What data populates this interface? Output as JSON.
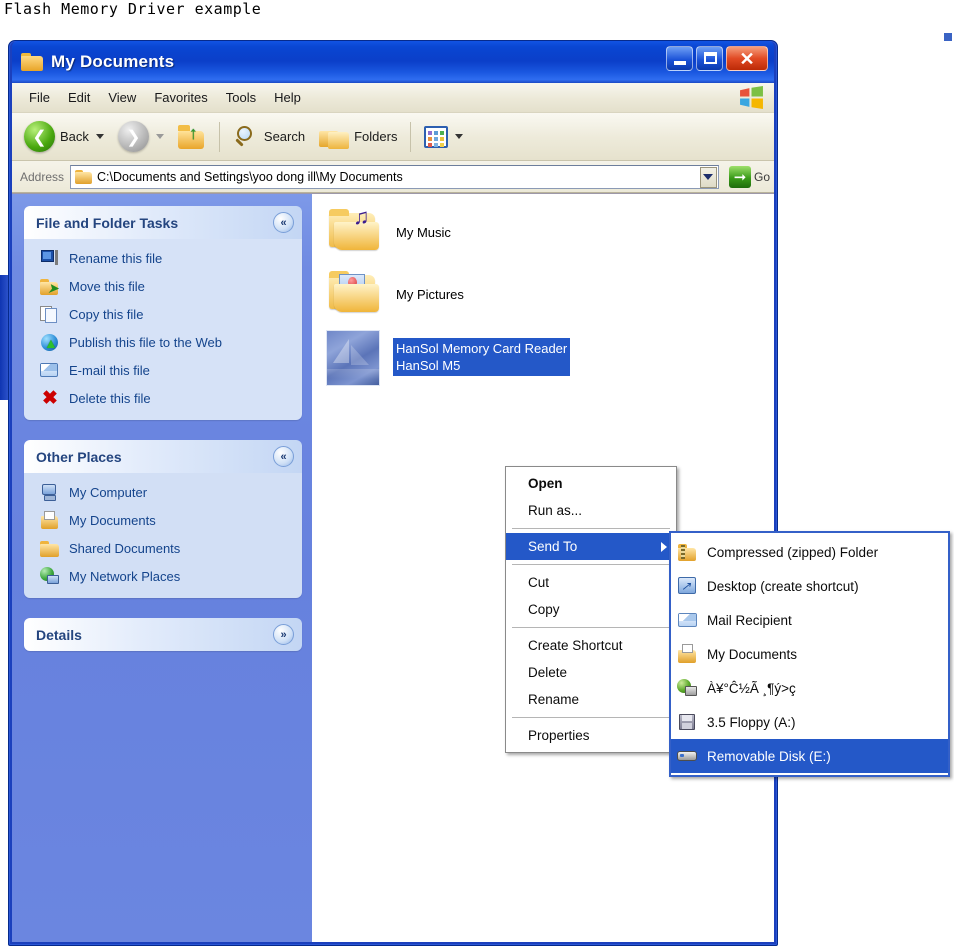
{
  "caption": "Flash Memory Driver example",
  "window": {
    "title": "My Documents",
    "buttons": {
      "minimize": "_",
      "maximize": "□",
      "close": "✕"
    }
  },
  "menubar": {
    "items": [
      "File",
      "Edit",
      "View",
      "Favorites",
      "Tools",
      "Help"
    ]
  },
  "toolbar": {
    "back_label": "Back",
    "forward_label": "",
    "up_label": "",
    "search_label": "Search",
    "folders_label": "Folders",
    "views_label": ""
  },
  "address": {
    "label": "Address",
    "value": "C:\\Documents and Settings\\yoo dong ill\\My Documents",
    "go_label": "Go"
  },
  "sidebar": {
    "panels": [
      {
        "title": "File and Folder Tasks",
        "collapse": "«",
        "items": [
          {
            "label": "Rename this file",
            "icon": "rename-icon"
          },
          {
            "label": "Move this file",
            "icon": "move-icon"
          },
          {
            "label": "Copy this file",
            "icon": "copy-icon"
          },
          {
            "label": "Publish this file to the Web",
            "icon": "globe-icon"
          },
          {
            "label": "E-mail this file",
            "icon": "mail-icon"
          },
          {
            "label": "Delete this file",
            "icon": "delete-icon"
          }
        ]
      },
      {
        "title": "Other Places",
        "collapse": "«",
        "items": [
          {
            "label": "My Computer",
            "icon": "computer-icon"
          },
          {
            "label": "My Documents",
            "icon": "my-documents-icon"
          },
          {
            "label": "Shared Documents",
            "icon": "folder-icon"
          },
          {
            "label": "My Network Places",
            "icon": "network-icon"
          }
        ]
      },
      {
        "title": "Details",
        "collapse": "»",
        "items": []
      }
    ]
  },
  "files": [
    {
      "name": "My Music",
      "icon": "music-folder-icon",
      "selected": false
    },
    {
      "name": "My Pictures",
      "icon": "pictures-folder-icon",
      "selected": false
    },
    {
      "name": "HanSol Memory Card Reader\nHanSol M5",
      "icon": "application-thumbnail-icon",
      "selected": true
    }
  ],
  "context_menu": {
    "items": [
      {
        "label": "Open",
        "bold": true,
        "separator_after": false
      },
      {
        "label": "Run as...",
        "bold": false,
        "separator_after": true
      },
      {
        "label": "Send To",
        "bold": false,
        "highlighted": true,
        "submenu": true,
        "separator_after": true
      },
      {
        "label": "Cut",
        "bold": false,
        "separator_after": false
      },
      {
        "label": "Copy",
        "bold": false,
        "separator_after": true
      },
      {
        "label": "Create Shortcut",
        "bold": false,
        "separator_after": false
      },
      {
        "label": "Delete",
        "bold": false,
        "separator_after": false
      },
      {
        "label": "Rename",
        "bold": false,
        "separator_after": true
      },
      {
        "label": "Properties",
        "bold": false,
        "separator_after": false
      }
    ]
  },
  "send_to_submenu": {
    "items": [
      {
        "label": "Compressed (zipped) Folder",
        "icon": "zip-folder-icon",
        "highlighted": false
      },
      {
        "label": "Desktop (create shortcut)",
        "icon": "desktop-shortcut-icon",
        "highlighted": false
      },
      {
        "label": "Mail Recipient",
        "icon": "mail-icon",
        "highlighted": false
      },
      {
        "label": "My Documents",
        "icon": "my-documents-icon",
        "highlighted": false
      },
      {
        "label": "À¥°Ĉ½Ã ¸¶ý>ç",
        "icon": "network-drive-icon",
        "highlighted": false
      },
      {
        "label": "3.5 Floppy (A:)",
        "icon": "floppy-icon",
        "highlighted": false
      },
      {
        "label": "Removable Disk (E:)",
        "icon": "removable-disk-icon",
        "highlighted": true
      }
    ]
  },
  "colors": {
    "titlebar_blue": "#0a46d2",
    "selection_blue": "#2458c8",
    "sidebar_blue": "#6b86e0",
    "panel_body": "#d6e2f7",
    "chrome": "#ece9d8",
    "link_blue": "#14448c",
    "close_red": "#e14a24"
  }
}
